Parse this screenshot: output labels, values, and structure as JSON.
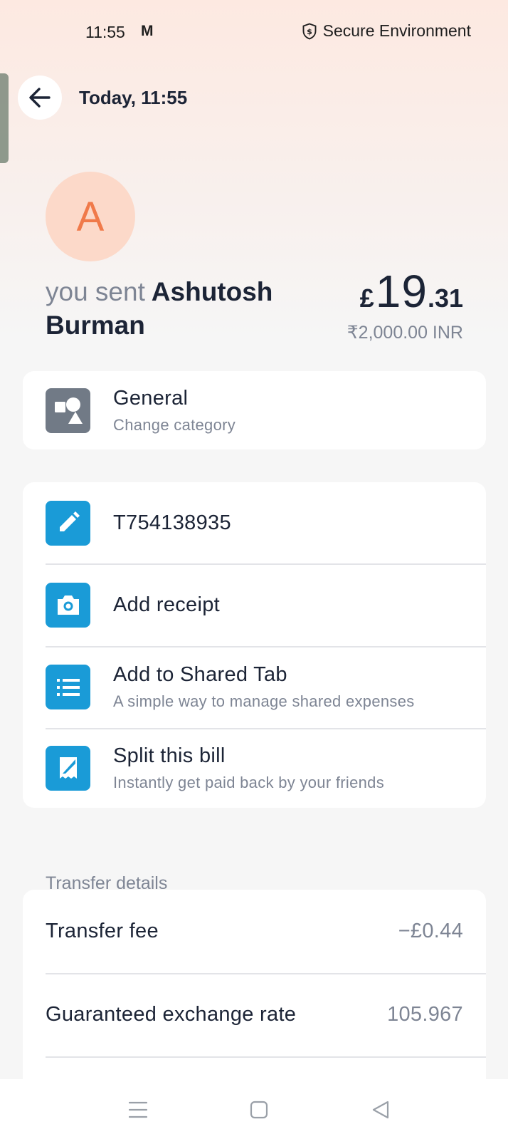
{
  "status_bar": {
    "time": "11:55",
    "notification_glyph": "M",
    "secure_label": "Secure Environment",
    "icons": [
      "shield-dollar-icon"
    ]
  },
  "header": {
    "title": "Today, 11:55",
    "back_icon": "arrow-left-icon"
  },
  "recipient": {
    "initial": "A",
    "prefix": "you sent",
    "name": "Ashutosh Burman"
  },
  "amount": {
    "currency_symbol": "£",
    "whole": "19",
    "fraction": ".31",
    "converted": "₹2,000.00 INR"
  },
  "category": {
    "title": "General",
    "subtitle": "Change category",
    "icon": "shapes-icon"
  },
  "actions": [
    {
      "title": "T754138935",
      "subtitle": "",
      "icon": "pencil-icon"
    },
    {
      "title": "Add receipt",
      "subtitle": "",
      "icon": "camera-icon"
    },
    {
      "title": "Add to Shared Tab",
      "subtitle": "A simple way to manage shared expenses",
      "icon": "list-icon"
    },
    {
      "title": "Split this bill",
      "subtitle": "Instantly get paid back by your friends",
      "icon": "receipt-split-icon"
    }
  ],
  "transfer_details": {
    "label": "Transfer details",
    "rows": [
      {
        "label": "Transfer fee",
        "value": "−£0.44"
      },
      {
        "label": "Guaranteed exchange rate",
        "value": "105.967"
      }
    ]
  },
  "nav_bar": {
    "icons": [
      "menu-icon",
      "home-square-icon",
      "back-triangle-icon"
    ]
  },
  "colors": {
    "accent_blue": "#1a9bd7",
    "avatar_bg": "#fcd9c9",
    "avatar_text": "#f07a4a",
    "text_primary": "#1c2436",
    "text_secondary": "#7e8594"
  }
}
